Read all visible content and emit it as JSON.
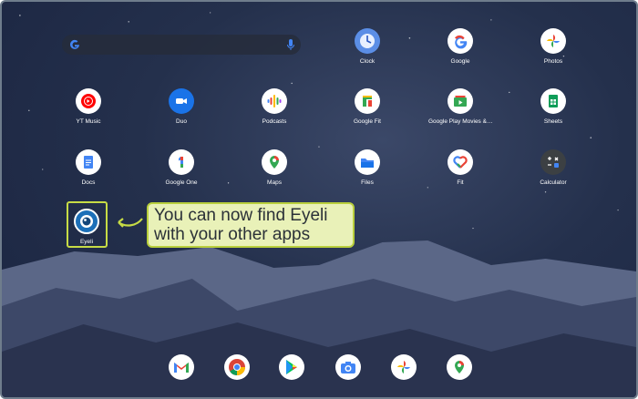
{
  "search": {
    "placeholder": ""
  },
  "apps": {
    "clock": "Clock",
    "google": "Google",
    "photos": "Photos",
    "yt_music": "YT Music",
    "duo": "Duo",
    "podcasts": "Podcasts",
    "google_fit": "Google Fit",
    "play_movies": "Google Play Movies &…",
    "sheets": "Sheets",
    "docs": "Docs",
    "google_one": "Google One",
    "maps": "Maps",
    "files": "Files",
    "fit": "Fit",
    "calculator": "Calculator",
    "eyeli": "Eyeli"
  },
  "callout": {
    "line1": "You can now find Eyeli",
    "line2": "with your other apps"
  },
  "dock": [
    "gmail-icon",
    "chrome-icon",
    "play-store-icon",
    "camera-icon",
    "photos-icon",
    "maps-icon"
  ],
  "colors": {
    "highlight": "#c7dc45",
    "callout_bg": "#e9f1b8"
  }
}
